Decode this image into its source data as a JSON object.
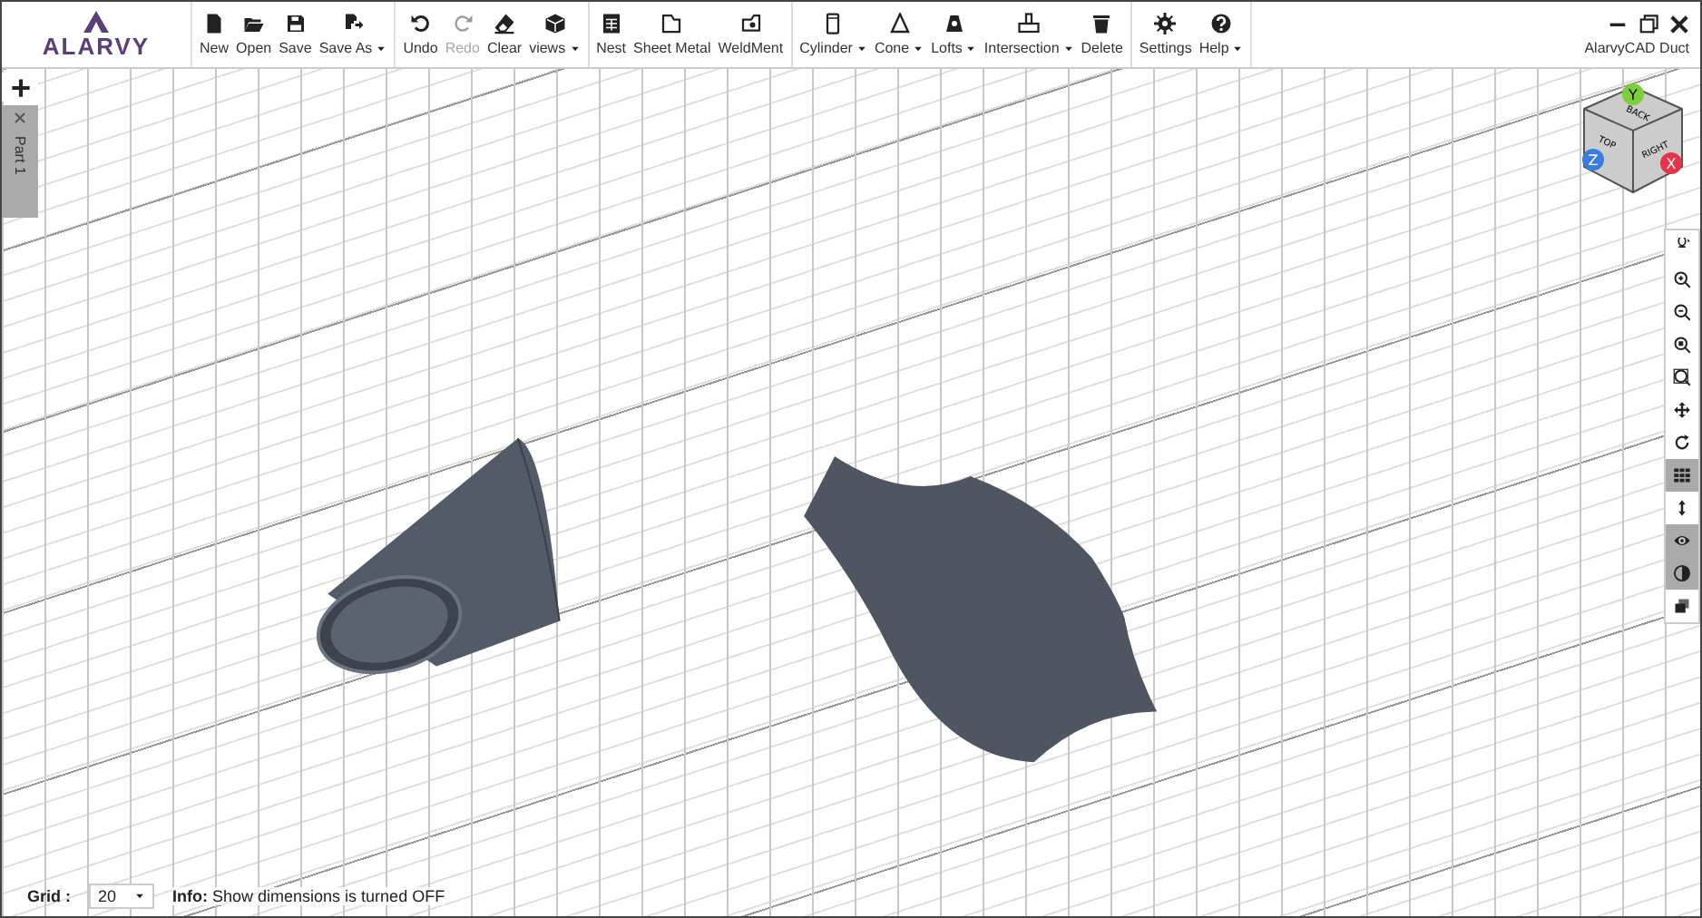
{
  "logo": {
    "text": "ALARVY"
  },
  "toolbar": {
    "groups": [
      {
        "items": [
          {
            "label": "New",
            "kind": "button",
            "disabled": false
          },
          {
            "label": "Open",
            "kind": "button",
            "disabled": false
          },
          {
            "label": "Save",
            "kind": "button",
            "disabled": false
          },
          {
            "label": "Save As",
            "kind": "dropdown",
            "disabled": false
          }
        ]
      },
      {
        "items": [
          {
            "label": "Undo",
            "kind": "button",
            "disabled": false
          },
          {
            "label": "Redo",
            "kind": "button",
            "disabled": true
          },
          {
            "label": "Clear",
            "kind": "button",
            "disabled": false
          },
          {
            "label": "views",
            "kind": "dropdown",
            "disabled": false
          }
        ]
      },
      {
        "items": [
          {
            "label": "Nest",
            "kind": "button",
            "disabled": false
          },
          {
            "label": "Sheet Metal",
            "kind": "button",
            "disabled": false
          },
          {
            "label": "WeldMent",
            "kind": "button",
            "disabled": false
          }
        ]
      },
      {
        "items": [
          {
            "label": "Cylinder",
            "kind": "dropdown",
            "disabled": false
          },
          {
            "label": "Cone",
            "kind": "dropdown",
            "disabled": false
          },
          {
            "label": "Lofts",
            "kind": "dropdown",
            "disabled": false
          },
          {
            "label": "Intersection",
            "kind": "dropdown",
            "disabled": false
          },
          {
            "label": "Delete",
            "kind": "button",
            "disabled": false
          }
        ]
      },
      {
        "items": [
          {
            "label": "Settings",
            "kind": "button",
            "disabled": false
          },
          {
            "label": "Help",
            "kind": "dropdown",
            "disabled": false
          }
        ]
      }
    ]
  },
  "window": {
    "title": "AlarvyCAD Duct"
  },
  "tabs": [
    {
      "label": "Part 1",
      "selected": true
    }
  ],
  "view_cube": {
    "back": "BACK",
    "top": "TOP",
    "right": "RIGHT",
    "y": "Y",
    "z": "Z",
    "x": "X"
  },
  "view_tools": [
    {
      "selected": false
    },
    {
      "selected": false
    },
    {
      "selected": false
    },
    {
      "selected": false
    },
    {
      "selected": false
    },
    {
      "selected": false
    },
    {
      "selected": false
    },
    {
      "selected": true
    },
    {
      "selected": false
    },
    {
      "selected": true
    },
    {
      "selected": true
    },
    {
      "selected": false
    }
  ],
  "status_bar": {
    "grid_label": "Grid :",
    "grid_value": "20",
    "info": "**Info:** Show dimensions is turned OFF"
  }
}
